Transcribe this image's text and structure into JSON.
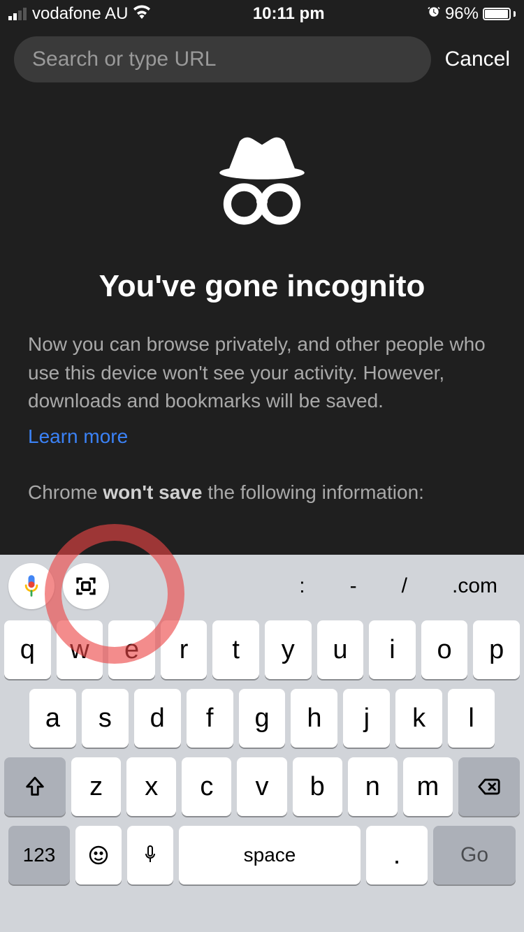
{
  "status": {
    "carrier": "vodafone AU",
    "time": "10:11 pm",
    "battery_pct": "96%"
  },
  "search": {
    "placeholder": "Search or type URL",
    "value": "",
    "cancel": "Cancel"
  },
  "incognito": {
    "title": "You've gone incognito",
    "desc": "Now you can browse privately, and other people who use this device won't see your activity. However, downloads and bookmarks will be saved.",
    "learn_more": "Learn more",
    "wont_save_prefix": "Chrome ",
    "wont_save_bold": "won't save",
    "wont_save_suffix": " the following information:"
  },
  "suggestions": {
    "items": [
      ":",
      "-",
      "/",
      ".com"
    ]
  },
  "keyboard": {
    "row1": [
      "q",
      "w",
      "e",
      "r",
      "t",
      "y",
      "u",
      "i",
      "o",
      "p"
    ],
    "row2": [
      "a",
      "s",
      "d",
      "f",
      "g",
      "h",
      "j",
      "k",
      "l"
    ],
    "row3": [
      "z",
      "x",
      "c",
      "v",
      "b",
      "n",
      "m"
    ],
    "key_123": "123",
    "space": "space",
    "dot": ".",
    "go": "Go"
  }
}
